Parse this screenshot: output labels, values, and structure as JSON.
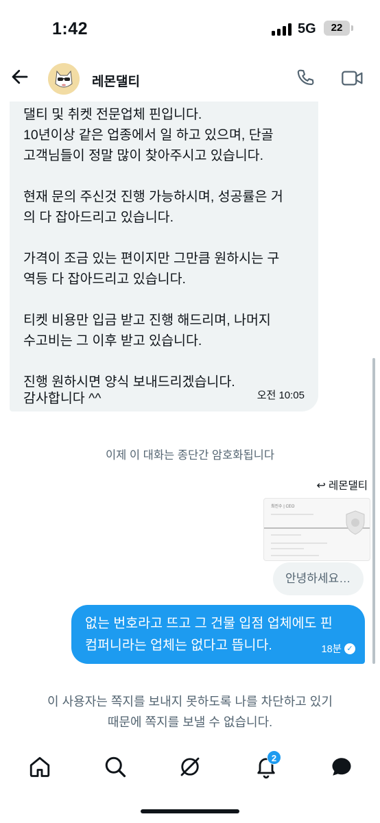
{
  "status_bar": {
    "time": "1:42",
    "network": "5G",
    "battery": "22"
  },
  "header": {
    "contact_name": "레몬댈티",
    "icons": [
      "back-arrow-icon",
      "phone-icon",
      "video-icon"
    ]
  },
  "incoming_message": {
    "lines": [
      "댈티 및 취켓 전문업체 핀입니다.",
      "10년이상 같은 업종에서 일 하고 있으며, 단골",
      "고객님들이 정말 많이 찾아주시고 있습니다.",
      "",
      "현재 문의 주신것 진행 가능하시며, 성공률은 거",
      "의 다 잡아드리고 있습니다.",
      "",
      "가격이 조금 있는 편이지만 그만큼 원하시는 구",
      "역등 다 잡아드리고 있습니다.",
      "",
      "티켓 비용만 입금 받고 진행 해드리며, 나머지",
      "수고비는 그 이후 받고 있습니다.",
      "",
      "진행 원하시면 양식 보내드리겠습니다.",
      "감사합니다 ^^"
    ],
    "time": "오전 10:05"
  },
  "encryption_notice": "이제 이 대화는 종단간 암호화됩니다",
  "forwarded": {
    "label": "레몬댈티",
    "card_name": "최진수 | CEO",
    "reply_preview": "안녕하세요…"
  },
  "outgoing_message": {
    "lines": [
      "없는 번호라고 뜨고 그 건물 입점 업체에도 핀",
      "컴퍼니라는 업체는 없다고 뜹니다."
    ],
    "time": "18분"
  },
  "blocked_notice": {
    "line1": "이 사용자는 쪽지를 보내지 못하도록 나를 차단하고 있기",
    "line2": "때문에 쪽지를 보낼 수 없습니다."
  },
  "tab_bar": {
    "tabs": [
      "home-icon",
      "search-icon",
      "grok-icon",
      "notifications-icon",
      "messages-icon"
    ],
    "notification_count": "2"
  },
  "colors": {
    "accent": "#1d9bf0",
    "incoming_bubble": "#eff3f4",
    "secondary_text": "#536471"
  }
}
